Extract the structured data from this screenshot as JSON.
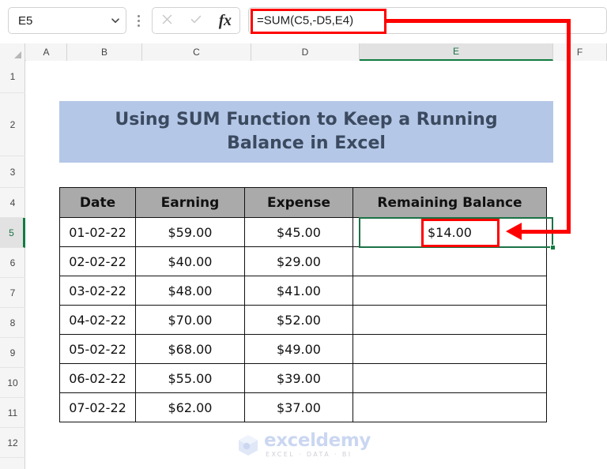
{
  "app": {
    "name_box_value": "E5",
    "formula_bar_value": "=SUM(C5,-D5,E4)",
    "cancel_icon": "close-icon",
    "confirm_icon": "check-icon",
    "function_icon": "fx-icon",
    "name_box_chevron": "chevron-down-icon",
    "more_options_icon": "kebab-menu-icon"
  },
  "grid": {
    "column_headers": [
      "A",
      "B",
      "C",
      "D",
      "E",
      "F"
    ],
    "selected_column": "E",
    "row_headers": [
      "1",
      "2",
      "3",
      "4",
      "5",
      "6",
      "7",
      "8",
      "9",
      "10",
      "11",
      "12"
    ],
    "selected_row": "5"
  },
  "banner": {
    "title": "Using SUM Function to Keep a Running Balance in Excel",
    "fill_color": "#b4c7e7"
  },
  "table": {
    "headers": [
      "Date",
      "Earning",
      "Expense",
      "Remaining Balance"
    ],
    "header_fill": "#aaaaaa",
    "rows": [
      {
        "date": "01-02-22",
        "earning": "$59.00",
        "expense": "$45.00",
        "balance": "$14.00"
      },
      {
        "date": "02-02-22",
        "earning": "$40.00",
        "expense": "$29.00",
        "balance": ""
      },
      {
        "date": "03-02-22",
        "earning": "$48.00",
        "expense": "$41.00",
        "balance": ""
      },
      {
        "date": "04-02-22",
        "earning": "$70.00",
        "expense": "$52.00",
        "balance": ""
      },
      {
        "date": "05-02-22",
        "earning": "$68.00",
        "expense": "$49.00",
        "balance": ""
      },
      {
        "date": "06-02-22",
        "earning": "$55.00",
        "expense": "$39.00",
        "balance": ""
      },
      {
        "date": "07-02-22",
        "earning": "$62.00",
        "expense": "$37.00",
        "balance": ""
      }
    ]
  },
  "annotation": {
    "color": "#ff0000",
    "highlight_formula": "=SUM(C5,-D5,E4)",
    "highlight_result": "$14.00"
  },
  "watermark": {
    "name": "exceldemy",
    "tagline": "EXCEL · DATA · BI"
  },
  "colors": {
    "selection_green": "#107c41",
    "header_gray": "#f5f5f5"
  }
}
